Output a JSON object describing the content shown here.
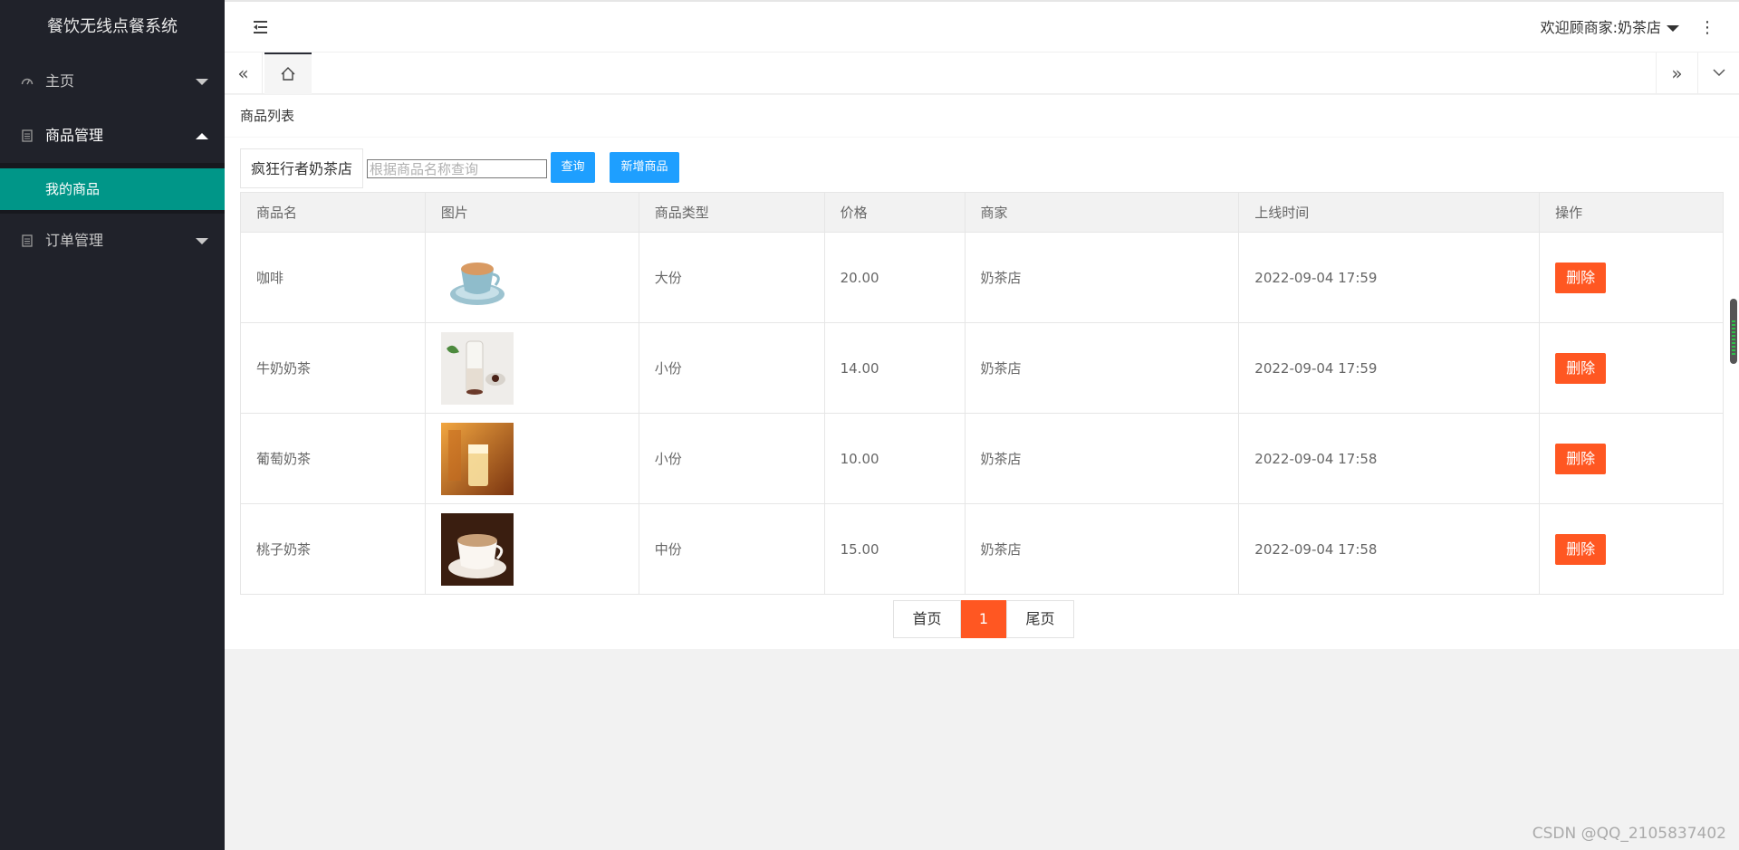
{
  "app": {
    "title": "餐饮无线点餐系统"
  },
  "sidebar": {
    "items": [
      {
        "label": "主页",
        "icon": "dashboard-icon",
        "expanded": false
      },
      {
        "label": "商品管理",
        "icon": "document-icon",
        "expanded": true,
        "children": [
          {
            "label": "我的商品",
            "active": true
          }
        ]
      },
      {
        "label": "订单管理",
        "icon": "document-icon",
        "expanded": false
      }
    ]
  },
  "header": {
    "welcome": "欢迎顾商家:奶茶店"
  },
  "page": {
    "title": "商品列表"
  },
  "toolbar": {
    "shop_name": "疯狂行者奶茶店",
    "search_placeholder": "根据商品名称查询",
    "search_value": "",
    "query_label": "查询",
    "add_label": "新增商品"
  },
  "table": {
    "columns": [
      "商品名",
      "图片",
      "商品类型",
      "价格",
      "商家",
      "上线时间",
      "操作"
    ],
    "rows": [
      {
        "name": "咖啡",
        "image": "coffee-cup-image",
        "type": "大份",
        "price": "20.00",
        "merchant": "奶茶店",
        "time": "2022-09-04 17:59",
        "action": "删除"
      },
      {
        "name": "牛奶奶茶",
        "image": "milk-tea-bottle-image",
        "type": "小份",
        "price": "14.00",
        "merchant": "奶茶店",
        "time": "2022-09-04 17:59",
        "action": "删除"
      },
      {
        "name": "葡萄奶茶",
        "image": "grape-milk-tea-image",
        "type": "小份",
        "price": "10.00",
        "merchant": "奶茶店",
        "time": "2022-09-04 17:58",
        "action": "删除"
      },
      {
        "name": "桃子奶茶",
        "image": "peach-milk-tea-cup-image",
        "type": "中份",
        "price": "15.00",
        "merchant": "奶茶店",
        "time": "2022-09-04 17:58",
        "action": "删除"
      }
    ]
  },
  "pager": {
    "first": "首页",
    "current": "1",
    "last": "尾页"
  },
  "watermark": "CSDN @QQ_2105837402",
  "colors": {
    "sidebar_bg": "#20222a",
    "accent": "#009688",
    "primary_button": "#1e9fff",
    "danger": "#ff5722"
  }
}
